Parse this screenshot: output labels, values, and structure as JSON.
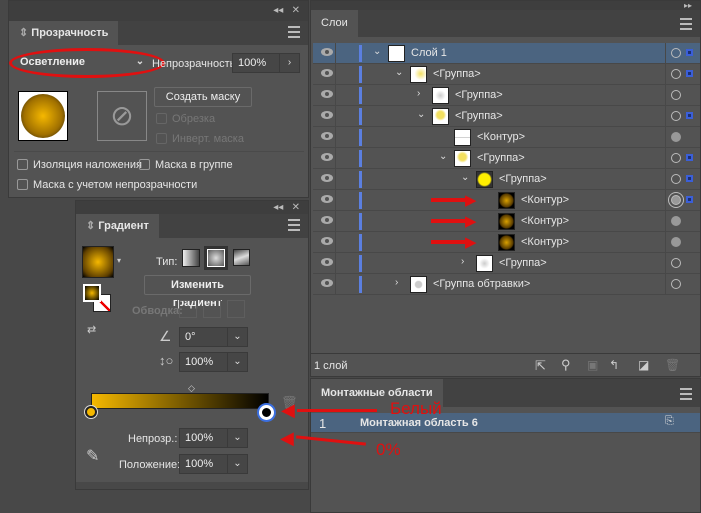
{
  "transparency": {
    "tab": "Прозрачность",
    "blend_mode": "Осветление",
    "opacity_label": "Непрозрачность:",
    "opacity_value": "100%",
    "make_mask": "Создать маску",
    "clip": "Обрезка",
    "invert_mask": "Инверт. маска",
    "isolate_blending": "Изоляция наложения",
    "knockout_group": "Маска в группе",
    "opacity_mask": "Маска с учетом непрозрачности"
  },
  "gradient": {
    "tab": "Градиент",
    "type_label": "Тип:",
    "edit_gradient": "Изменить градиент",
    "stroke_label": "Обводка:",
    "angle": "0°",
    "aspect": "100%",
    "opacity_label": "Непрозр.:",
    "opacity_value": "100%",
    "location_label": "Положение:",
    "location_value": "100%",
    "start_color": "#f5b800",
    "end_color": "#000000"
  },
  "layers": {
    "tab": "Слои",
    "footer": "1 слой",
    "rows": [
      {
        "name": "Слой 1",
        "level": 0,
        "chev": "down",
        "sel": true,
        "target": "ring",
        "square": true,
        "thumb": "layer"
      },
      {
        "name": "<Группа>",
        "level": 1,
        "chev": "down",
        "target": "ring",
        "square": true,
        "thumb": "bulbs"
      },
      {
        "name": "<Группа>",
        "level": 2,
        "chev": "right",
        "target": "ring",
        "thumb": "bulb"
      },
      {
        "name": "<Группа>",
        "level": 2,
        "chev": "down",
        "target": "ring",
        "square": true,
        "thumb": "bulbyellow"
      },
      {
        "name": "<Контур>",
        "level": 3,
        "chev": "none",
        "target": "fill",
        "thumb": "line"
      },
      {
        "name": "<Группа>",
        "level": 3,
        "chev": "down",
        "target": "ring",
        "square": true,
        "thumb": "bulbyellow"
      },
      {
        "name": "<Группа>",
        "level": 4,
        "chev": "down",
        "target": "ring",
        "square": true,
        "thumb": "yellow"
      },
      {
        "name": "<Контур>",
        "level": 5,
        "chev": "none",
        "target": "double",
        "square": true,
        "thumb": "dark",
        "arrow": true
      },
      {
        "name": "<Контур>",
        "level": 5,
        "chev": "none",
        "target": "fill",
        "thumb": "dark",
        "arrow": true
      },
      {
        "name": "<Контур>",
        "level": 5,
        "chev": "none",
        "target": "fill",
        "thumb": "dark",
        "arrow": true
      },
      {
        "name": "<Группа>",
        "level": 4,
        "chev": "right",
        "target": "ring",
        "thumb": "bulb"
      },
      {
        "name": "<Группа обтравки>",
        "level": 1,
        "chev": "right",
        "target": "ring",
        "thumb": "gray"
      }
    ]
  },
  "artboards": {
    "tab": "Монтажные области",
    "rows": [
      {
        "index": "1",
        "name": "Монтажная область 6"
      }
    ]
  },
  "annotations": {
    "white": "Белый",
    "zero": "0%"
  }
}
